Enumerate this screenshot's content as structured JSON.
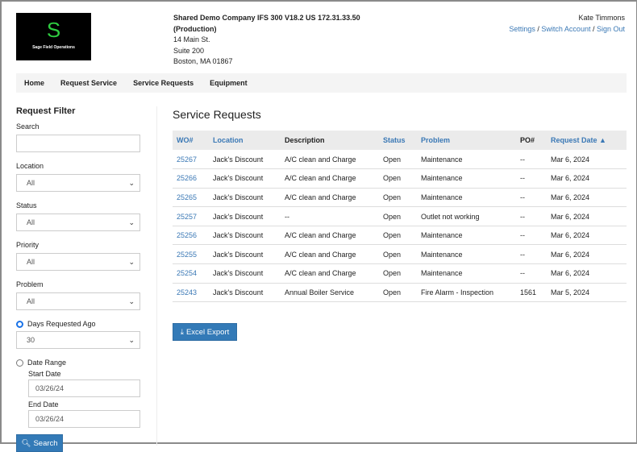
{
  "logo": {
    "letter": "S",
    "text": "Sage Field Operations"
  },
  "company": {
    "name": "Shared Demo Company IFS 300 V18.2 US 172.31.33.50",
    "env": "(Production)",
    "address1": "14 Main St.",
    "address2": "Suite 200",
    "city": "Boston, MA 01867"
  },
  "user": {
    "name": "Kate Timmons",
    "settings": "Settings",
    "switch": "Switch Account",
    "signout": "Sign Out",
    "sep": " / "
  },
  "nav": [
    "Home",
    "Request Service",
    "Service Requests",
    "Equipment"
  ],
  "filter": {
    "title": "Request Filter",
    "search_label": "Search",
    "search_value": "",
    "location_label": "Location",
    "location_value": "All",
    "status_label": "Status",
    "status_value": "All",
    "priority_label": "Priority",
    "priority_value": "All",
    "problem_label": "Problem",
    "problem_value": "All",
    "days_label": "Days Requested Ago",
    "days_value": "30",
    "days_selected": true,
    "range_label": "Date Range",
    "start_label": "Start Date",
    "start_value": "03/26/24",
    "end_label": "End Date",
    "end_value": "03/26/24",
    "search_button": "Search"
  },
  "main": {
    "title": "Service Requests",
    "export_button": "Excel Export",
    "columns": [
      "WO#",
      "Location",
      "Description",
      "Status",
      "Problem",
      "PO#",
      "Request Date"
    ],
    "sort_indicator": "▲",
    "rows": [
      [
        "25267",
        "Jack's Discount",
        "A/C clean and Charge",
        "Open",
        "Maintenance",
        "--",
        "Mar 6, 2024"
      ],
      [
        "25266",
        "Jack's Discount",
        "A/C clean and Charge",
        "Open",
        "Maintenance",
        "--",
        "Mar 6, 2024"
      ],
      [
        "25265",
        "Jack's Discount",
        "A/C clean and Charge",
        "Open",
        "Maintenance",
        "--",
        "Mar 6, 2024"
      ],
      [
        "25257",
        "Jack's Discount",
        "--",
        "Open",
        "Outlet not working",
        "--",
        "Mar 6, 2024"
      ],
      [
        "25256",
        "Jack's Discount",
        "A/C clean and Charge",
        "Open",
        "Maintenance",
        "--",
        "Mar 6, 2024"
      ],
      [
        "25255",
        "Jack's Discount",
        "A/C clean and Charge",
        "Open",
        "Maintenance",
        "--",
        "Mar 6, 2024"
      ],
      [
        "25254",
        "Jack's Discount",
        "A/C clean and Charge",
        "Open",
        "Maintenance",
        "--",
        "Mar 6, 2024"
      ],
      [
        "25243",
        "Jack's Discount",
        "Annual Boiler Service",
        "Open",
        "Fire Alarm - Inspection",
        "1561",
        "Mar 5, 2024"
      ]
    ]
  },
  "colors": {
    "link": "#3a78b5",
    "button": "#337ab7",
    "logo_green": "#2ecc40"
  }
}
